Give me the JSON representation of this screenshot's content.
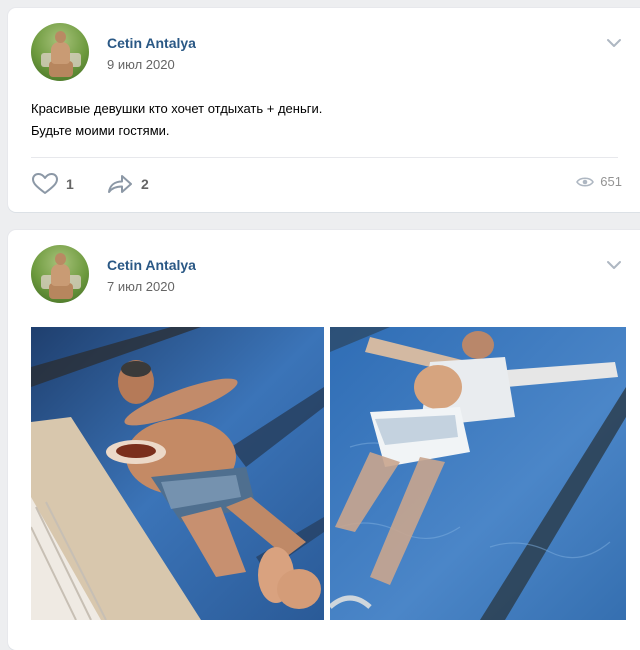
{
  "posts": [
    {
      "author": "Cetin Antalya",
      "date": "9 июл 2020",
      "text_lines": [
        "Красивые девушки кто хочет отдыхать + деньги.",
        "Будьте моими гостями."
      ],
      "likes": "1",
      "shares": "2",
      "views": "651",
      "icons": {
        "like": "heart-icon",
        "share": "share-arrow-icon",
        "views": "eye-icon",
        "menu": "chevron-down-icon"
      }
    },
    {
      "author": "Cetin Antalya",
      "date": "7 июл 2020",
      "photos": [
        "pool-photo-man-with-plate",
        "pool-photo-man-floating"
      ]
    }
  ],
  "colors": {
    "author_link": "#2a5885",
    "page_bg": "#edeef0",
    "action_gray": "#656565",
    "views_gray": "#939393",
    "pool_blue": "#3b74b8"
  }
}
